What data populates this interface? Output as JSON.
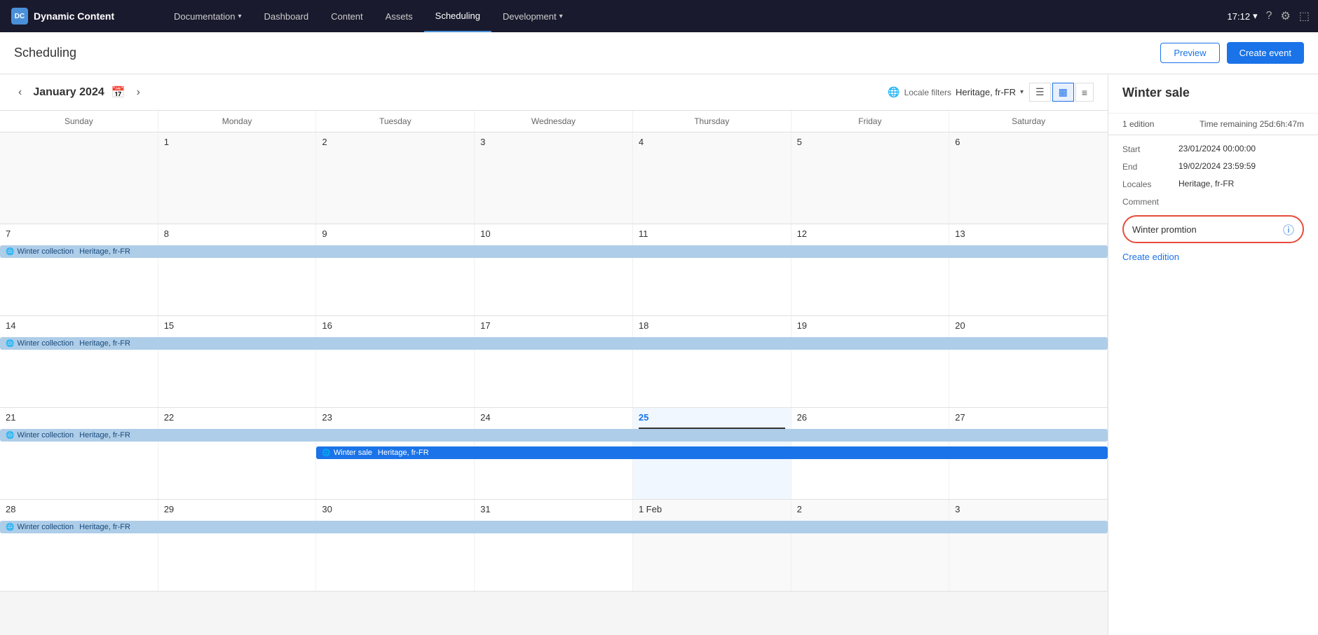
{
  "app": {
    "logo": "DC",
    "title": "Dynamic Content"
  },
  "nav": {
    "items": [
      {
        "label": "Documentation",
        "hasChevron": true,
        "active": false
      },
      {
        "label": "Dashboard",
        "hasChevron": false,
        "active": false
      },
      {
        "label": "Content",
        "hasChevron": false,
        "active": false
      },
      {
        "label": "Assets",
        "hasChevron": false,
        "active": false
      },
      {
        "label": "Scheduling",
        "hasChevron": false,
        "active": true
      },
      {
        "label": "Development",
        "hasChevron": true,
        "active": false
      }
    ],
    "time": "17:12",
    "time_chevron": "▾"
  },
  "header": {
    "title": "Scheduling",
    "preview_btn": "Preview",
    "create_btn": "Create event"
  },
  "calendar": {
    "month": "January 2024",
    "locale_label": "Locale filters",
    "locale_value": "Heritage, fr-FR",
    "day_names": [
      "Sunday",
      "Monday",
      "Tuesday",
      "Wednesday",
      "Thursday",
      "Friday",
      "Saturday"
    ],
    "weeks": [
      {
        "days": [
          {
            "num": "",
            "outside": true
          },
          {
            "num": "1",
            "outside": true
          },
          {
            "num": "2",
            "outside": true
          },
          {
            "num": "3",
            "outside": true
          },
          {
            "num": "4",
            "outside": true
          },
          {
            "num": "5",
            "outside": true
          },
          {
            "num": "6",
            "outside": true
          }
        ],
        "events": []
      },
      {
        "days": [
          {
            "num": "7"
          },
          {
            "num": "8"
          },
          {
            "num": "9"
          },
          {
            "num": "10"
          },
          {
            "num": "11"
          },
          {
            "num": "12"
          },
          {
            "num": "13"
          }
        ],
        "events": [
          {
            "type": "winter-collection-span",
            "label": "Winter collection",
            "hasGlobe": true,
            "locale": "Heritage, fr-FR",
            "col_start": 1,
            "col_span": 7
          }
        ]
      },
      {
        "days": [
          {
            "num": "14"
          },
          {
            "num": "15"
          },
          {
            "num": "16"
          },
          {
            "num": "17"
          },
          {
            "num": "18"
          },
          {
            "num": "19"
          },
          {
            "num": "20"
          }
        ],
        "events": [
          {
            "type": "winter-collection-span",
            "label": "Winter collection",
            "hasGlobe": true,
            "locale": "Heritage, fr-FR",
            "col_start": 1,
            "col_span": 7
          }
        ]
      },
      {
        "days": [
          {
            "num": "21"
          },
          {
            "num": "22"
          },
          {
            "num": "23"
          },
          {
            "num": "24"
          },
          {
            "num": "25",
            "today": true
          },
          {
            "num": "26"
          },
          {
            "num": "27"
          }
        ],
        "events": [
          {
            "type": "winter-collection-span",
            "label": "Winter collection",
            "hasGlobe": true,
            "locale": "Heritage, fr-FR",
            "col_start": 1,
            "col_span": 7
          },
          {
            "type": "winter-sale-span",
            "label": "Winter sale",
            "hasGlobe": true,
            "locale": "Heritage, fr-FR",
            "col_start": 3,
            "col_span": 5
          }
        ]
      },
      {
        "days": [
          {
            "num": "28"
          },
          {
            "num": "29"
          },
          {
            "num": "30"
          },
          {
            "num": "31"
          },
          {
            "num": "1 Feb",
            "outside": false
          },
          {
            "num": "2"
          },
          {
            "num": "3"
          }
        ],
        "events": [
          {
            "type": "winter-collection-span",
            "label": "Winter collection",
            "hasGlobe": true,
            "locale": "Heritage, fr-FR",
            "col_start": 1,
            "col_span": 7
          }
        ]
      }
    ]
  },
  "sidebar": {
    "title": "Winter sale",
    "edition_count": "1 edition",
    "time_remaining_label": "Time remaining",
    "time_remaining_value": "25d:6h:47m",
    "start_label": "Start",
    "start_value": "23/01/2024 00:00:00",
    "end_label": "End",
    "end_value": "19/02/2024 23:59:59",
    "locales_label": "Locales",
    "locales_value": "Heritage, fr-FR",
    "comment_label": "Comment",
    "comment_value": "",
    "promotion_name": "Winter promtion",
    "create_edition": "Create edition"
  }
}
